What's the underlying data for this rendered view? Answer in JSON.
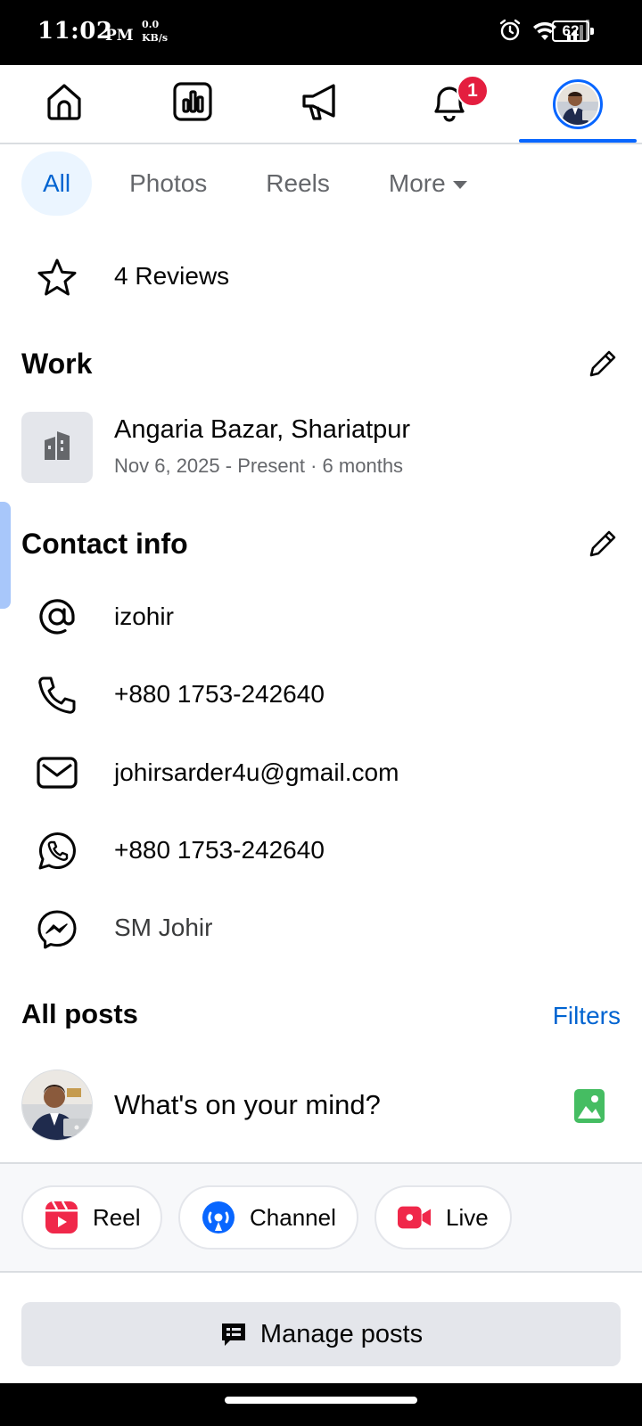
{
  "status_bar": {
    "time": "11:02",
    "ampm": "PM",
    "net_speed_value": "0.0",
    "net_speed_unit": "KB/s",
    "battery": "62",
    "icons": [
      "alarm-icon",
      "wifi-icon",
      "signal-icon",
      "battery-icon"
    ]
  },
  "top_nav": {
    "items": [
      "home-icon",
      "dashboard-icon",
      "megaphone-icon",
      "bell-icon",
      "profile-avatar"
    ],
    "notification_count": "1",
    "active_index": 4,
    "accent_color": "#0866ff",
    "badge_color": "#e41e3f"
  },
  "tabs": {
    "items": [
      {
        "label": "All",
        "active": true
      },
      {
        "label": "Photos",
        "active": false
      },
      {
        "label": "Reels",
        "active": false
      },
      {
        "label": "More",
        "active": false
      }
    ]
  },
  "reviews": {
    "label": "4 Reviews",
    "icon": "star-icon"
  },
  "work": {
    "title": "Work",
    "place": "Angaria Bazar, Shariatpur",
    "duration": "Nov 6, 2025 - Present · 6 months",
    "icon": "building-icon"
  },
  "contact": {
    "title": "Contact info",
    "items": [
      {
        "icon": "at-sign-icon",
        "value": "izohir"
      },
      {
        "icon": "phone-icon",
        "value": "+880 1753-242640"
      },
      {
        "icon": "mail-icon",
        "value": "johirsarder4u@gmail.com"
      },
      {
        "icon": "whatsapp-icon",
        "value": "+880 1753-242640"
      },
      {
        "icon": "messenger-icon",
        "value": "SM Johir"
      }
    ]
  },
  "posts": {
    "title": "All posts",
    "filters_label": "Filters",
    "composer_placeholder": "What's on your mind?",
    "photo_icon_color": "#45bd62"
  },
  "actions": {
    "reel": "Reel",
    "channel": "Channel",
    "live": "Live"
  },
  "manage_posts": "Manage posts"
}
